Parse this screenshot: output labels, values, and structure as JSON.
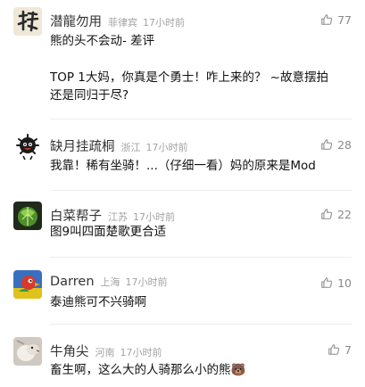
{
  "comments": [
    {
      "username": "潜龍勿用",
      "location": "菲律宾",
      "time": "17小时前",
      "likes": "77",
      "avatar": "calligraphy-avatar",
      "lines": [
        "熊的头不会动- 差评",
        "TOP 1大妈，你真是个勇士！咋上来的？ ~故意摆拍",
        "还是同归于尽?"
      ]
    },
    {
      "username": "缺月挂疏桐",
      "location": "浙江",
      "time": "17小时前",
      "likes": "28",
      "avatar": "black-fluffy-avatar",
      "lines": [
        "我靠！稀有坐骑！...（仔细一看）妈的原来是Mod"
      ]
    },
    {
      "username": "白菜帮子",
      "location": "江苏",
      "time": "17小时前",
      "likes": "22",
      "avatar": "green-cabbage-avatar",
      "lines": [
        "图9叫四面楚歌更合适"
      ]
    },
    {
      "username": "Darren",
      "location": "上海",
      "time": "17小时前",
      "likes": "10",
      "avatar": "colorful-bird-avatar",
      "lines": [
        "泰迪熊可不兴骑啊"
      ]
    },
    {
      "username": "牛角尖",
      "location": "河南",
      "time": "17小时前",
      "likes": "7",
      "avatar": "animal-photo-avatar",
      "lines": [
        "畜生啊，这么大的人骑那么小的熊"
      ],
      "emoji": "🐻"
    }
  ],
  "like_icon": "thumbs-up-icon",
  "colors": {
    "username": "#333333",
    "meta": "#a3a3a3",
    "like": "#8a8a8a",
    "text": "#111111",
    "divider": "#ededed"
  }
}
